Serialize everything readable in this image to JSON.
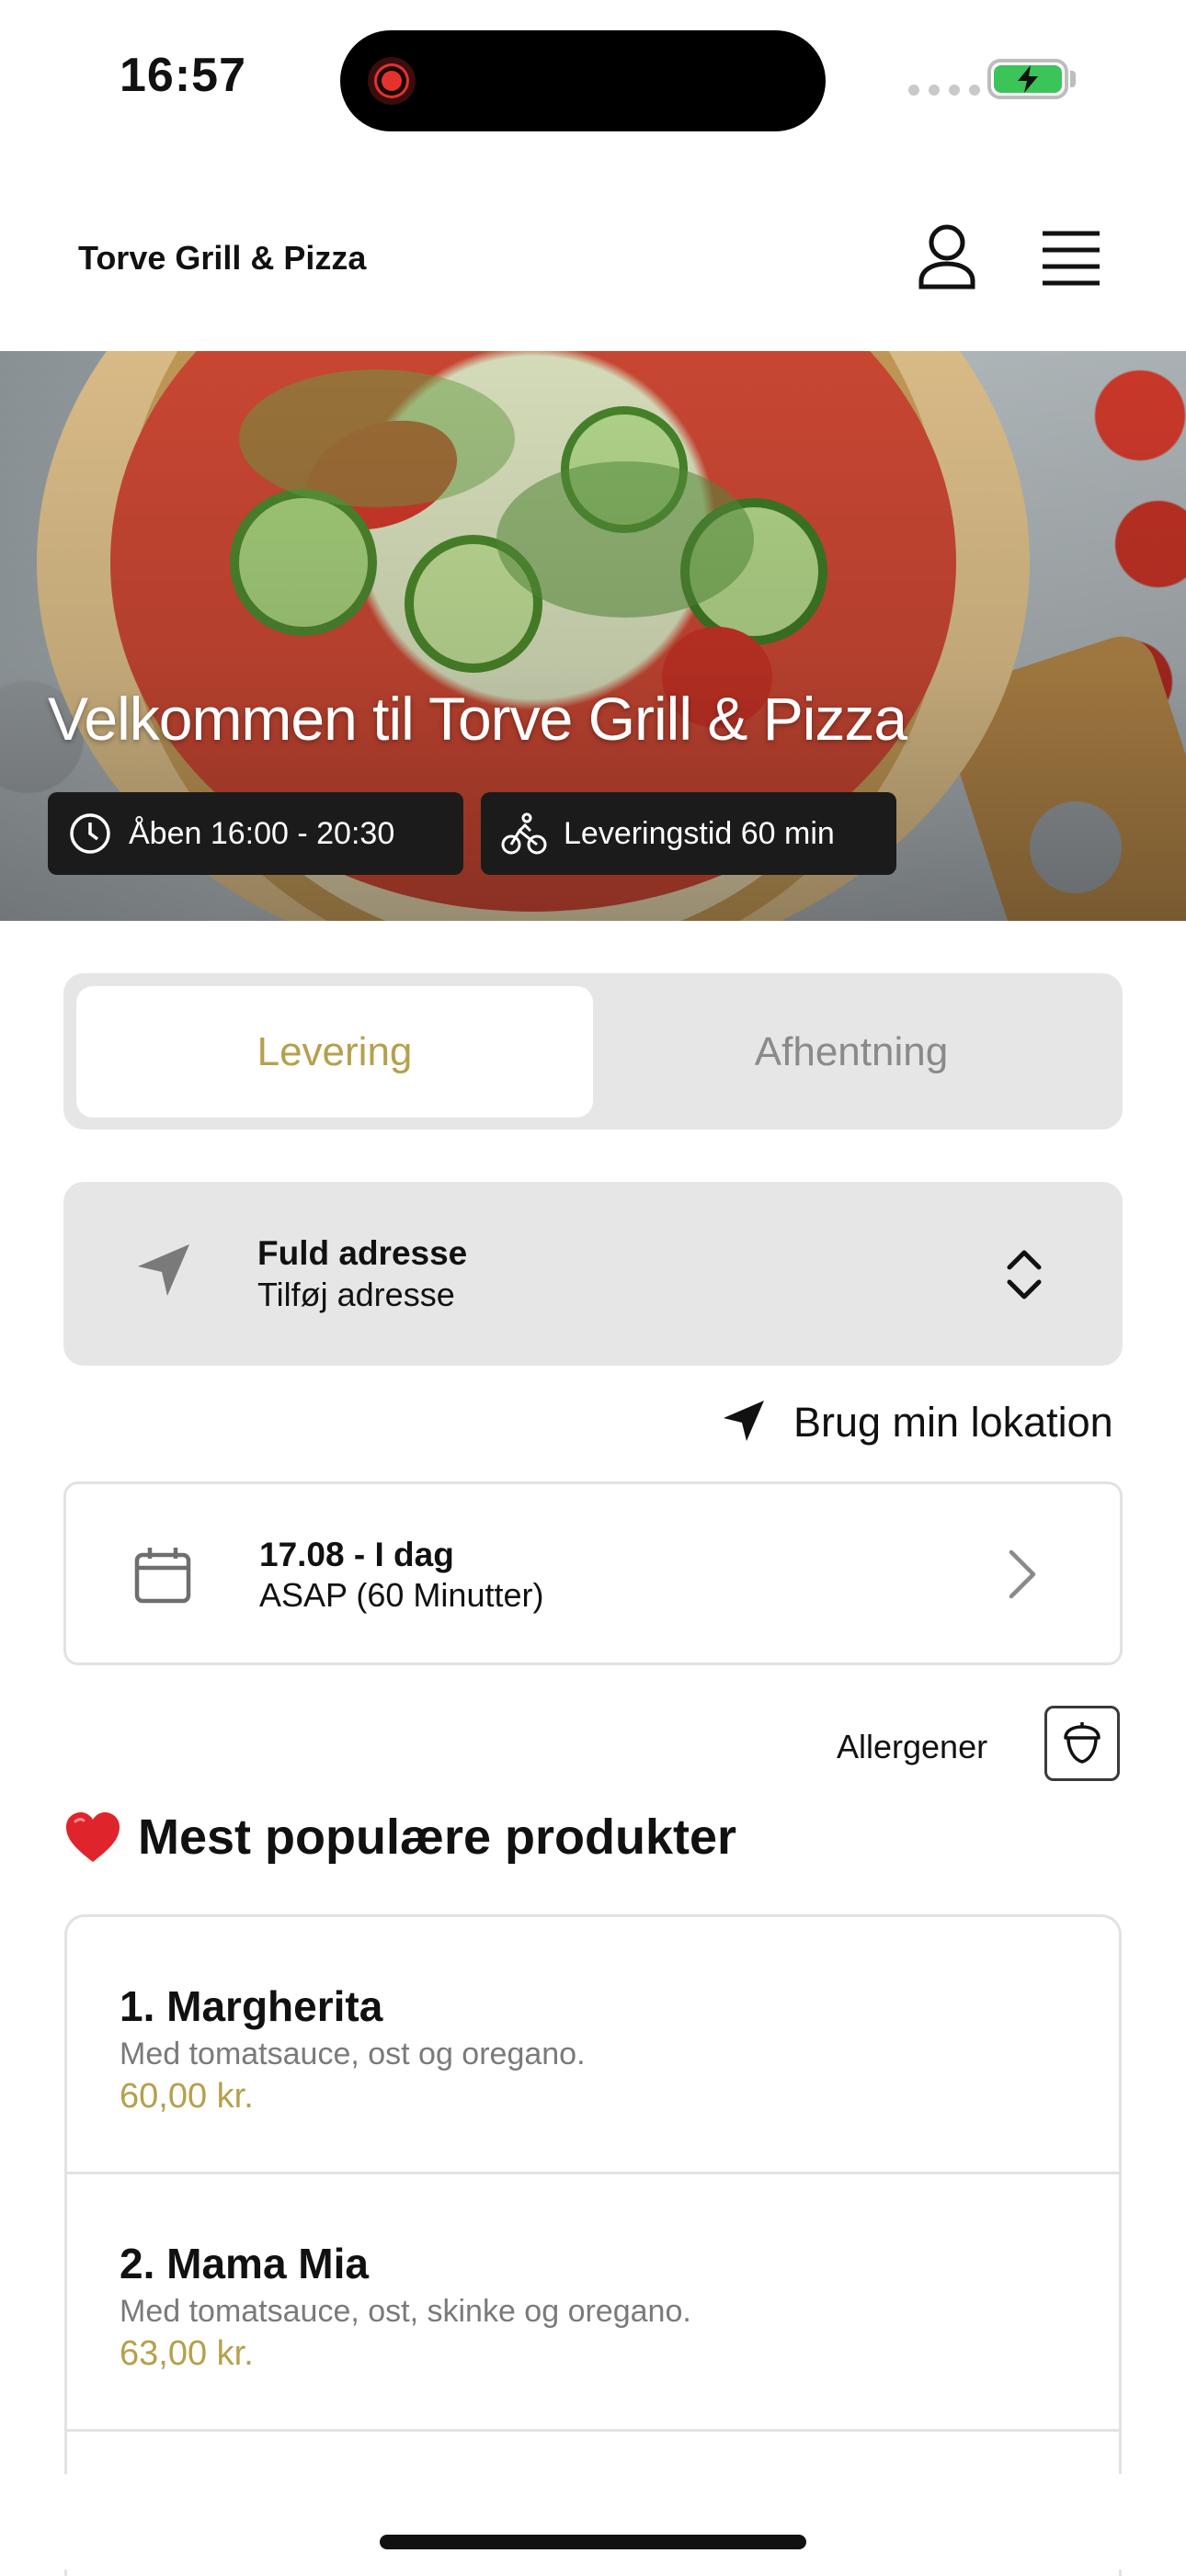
{
  "status_bar": {
    "time": "16:57"
  },
  "header": {
    "brand": "Torve Grill & Pizza"
  },
  "hero": {
    "title": "Velkommen til Torve Grill & Pizza",
    "hours_chip": "Åben 16:00 - 20:30",
    "delivery_chip": "Leveringstid 60 min"
  },
  "mode_tabs": [
    {
      "label": "Levering",
      "active": true
    },
    {
      "label": "Afhentning",
      "active": false
    }
  ],
  "address": {
    "title": "Fuld adresse",
    "subtitle": "Tilføj adresse"
  },
  "location_button": "Brug min lokation",
  "schedule": {
    "title": "17.08 - I dag",
    "subtitle": "ASAP (60 Minutter)"
  },
  "allergens_label": "Allergener",
  "section_title": "Mest populære produkter",
  "products": [
    {
      "name": "1. Margherita",
      "description": "Med tomatsauce, ost og oregano.",
      "price": "60,00 kr."
    },
    {
      "name": "2. Mama Mia",
      "description": "Med tomatsauce, ost, skinke og oregano.",
      "price": "63,00 kr."
    }
  ],
  "colors": {
    "accent": "#b5a04c",
    "panel": "#e6e6e6",
    "chip": "#1b1b1b"
  },
  "icons": [
    "user-icon",
    "menu-icon",
    "clock-icon",
    "bicycle-icon",
    "navigation-arrow-icon",
    "chevron-updown-icon",
    "calendar-icon",
    "chevron-right-icon",
    "acorn-icon",
    "heart-icon"
  ]
}
